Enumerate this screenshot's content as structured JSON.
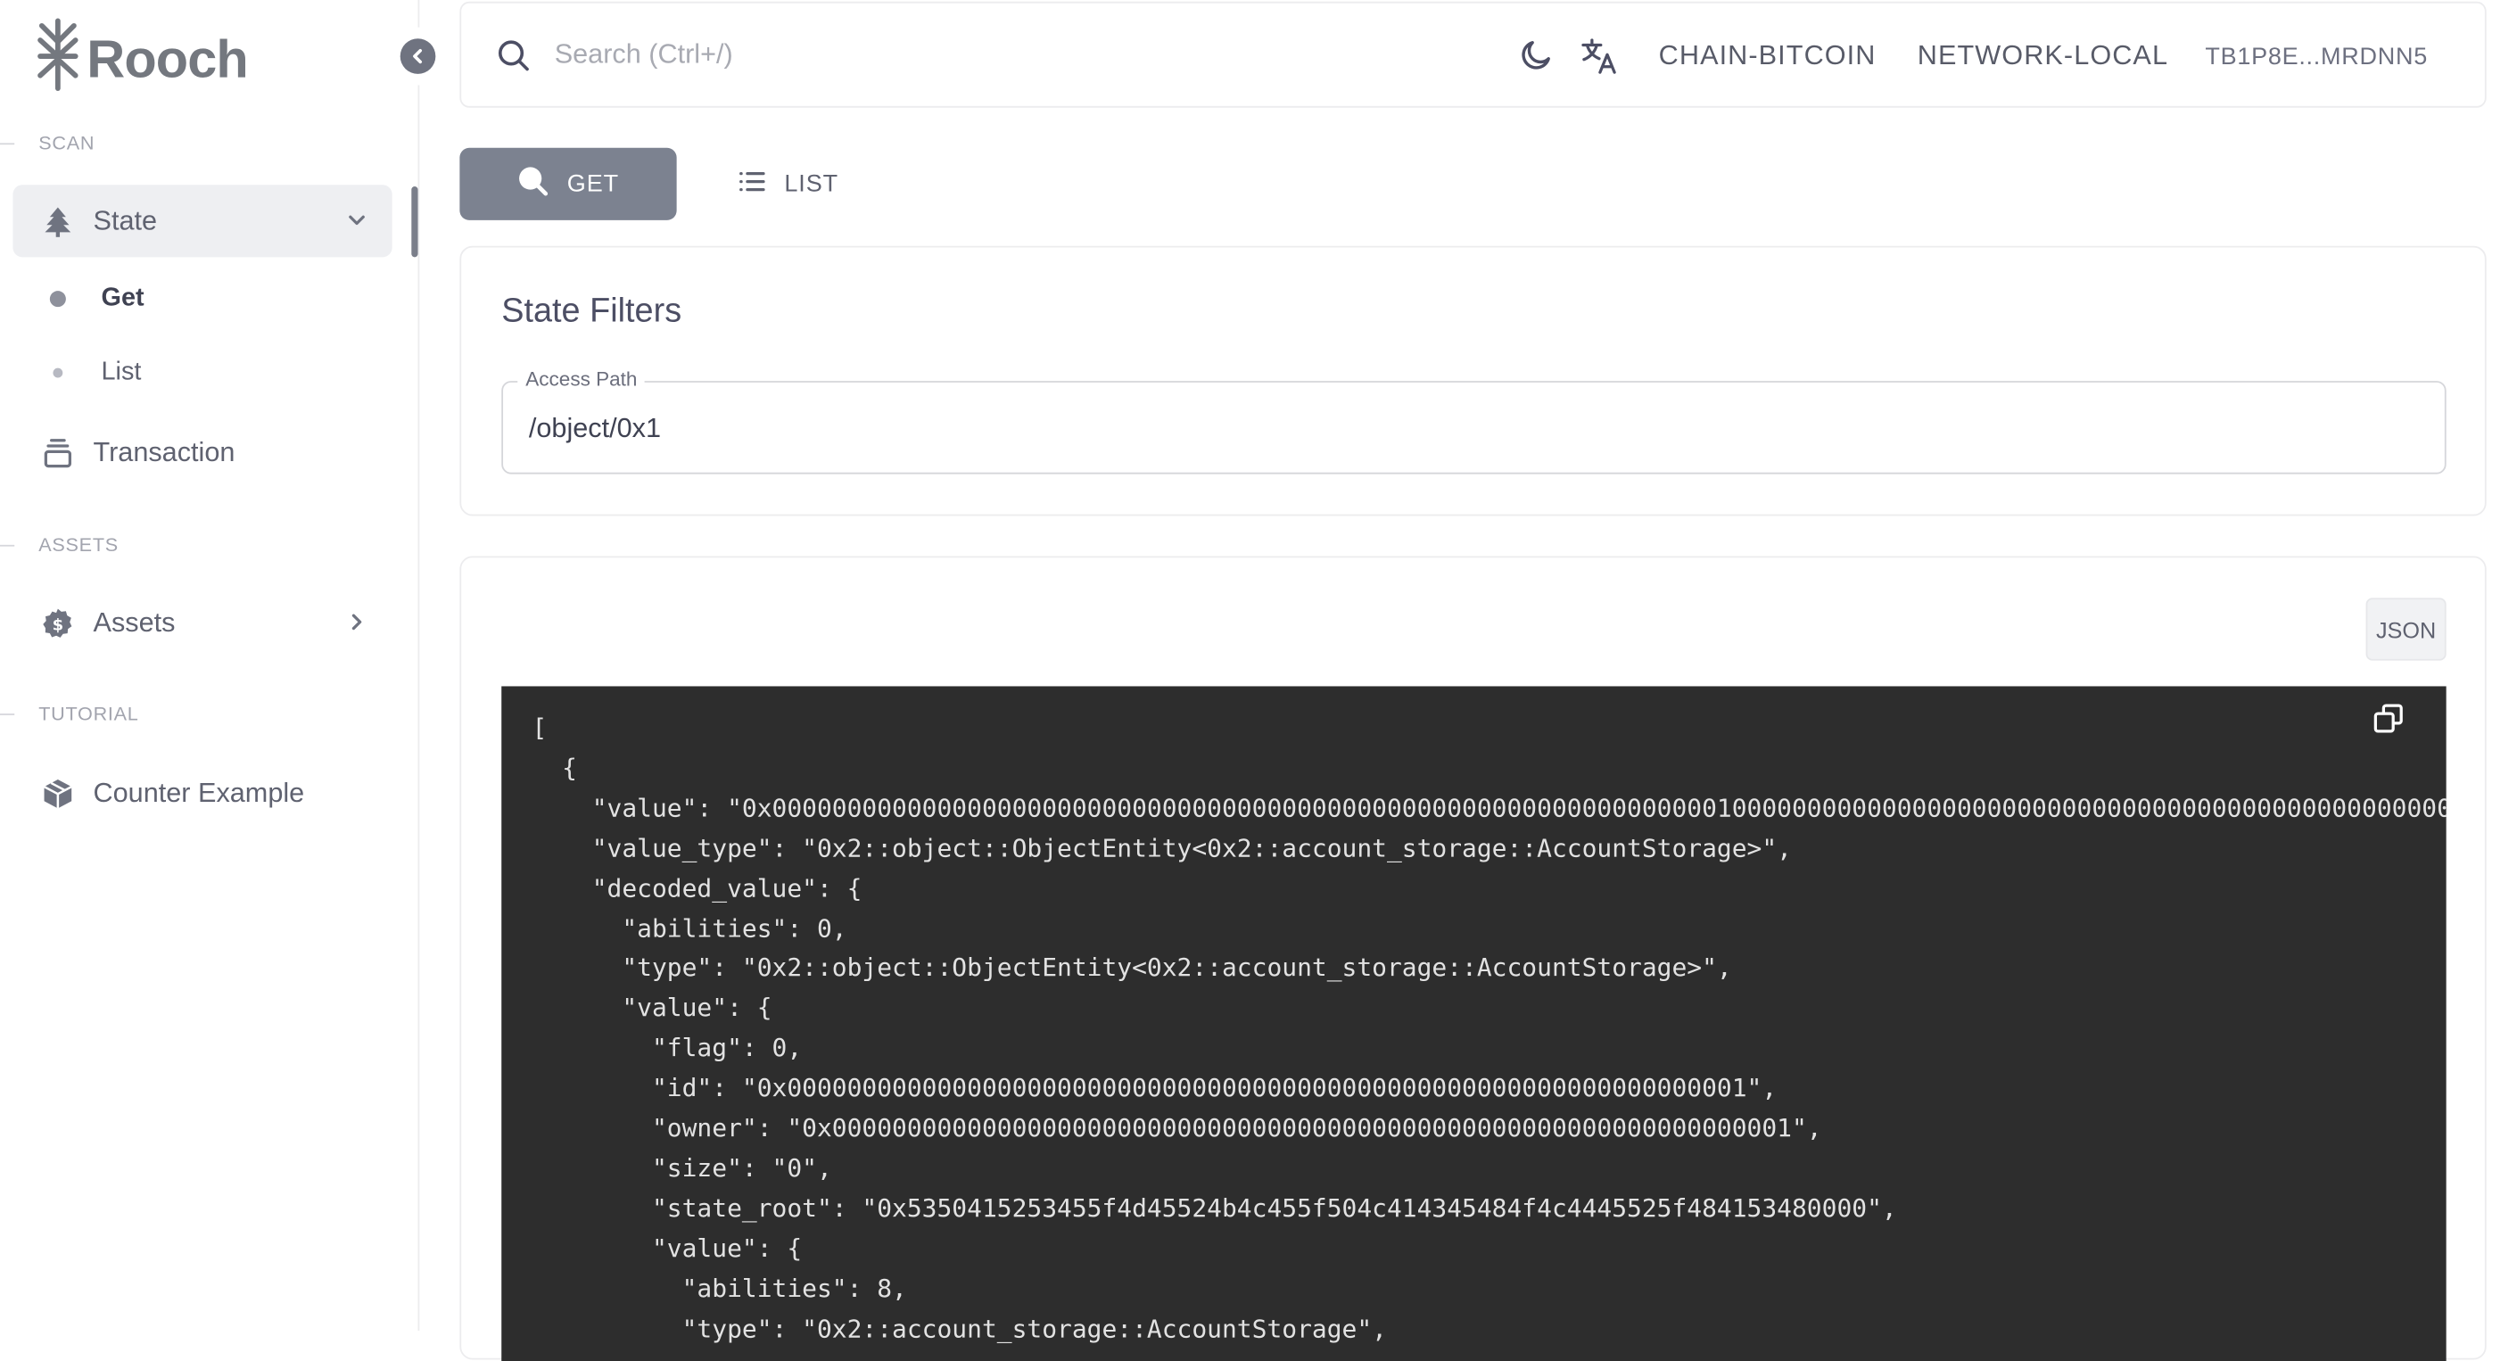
{
  "brand": {
    "name": "Rooch"
  },
  "sidebar": {
    "sections": {
      "scan": "SCAN",
      "assets": "ASSETS",
      "tutorial": "TUTORIAL"
    },
    "state": {
      "label": "State",
      "icon": "tree-icon",
      "expanded": true
    },
    "state_children": [
      {
        "label": "Get",
        "active": true
      },
      {
        "label": "List",
        "active": false
      }
    ],
    "transaction": {
      "label": "Transaction",
      "icon": "stack-icon"
    },
    "assets": {
      "label": "Assets",
      "icon": "dollar-badge-icon"
    },
    "counter_example": {
      "label": "Counter Example",
      "icon": "package-icon"
    }
  },
  "topbar": {
    "search_placeholder": "Search (Ctrl+/)",
    "chain": "CHAIN-BITCOIN",
    "network": "NETWORK-LOCAL",
    "wallet": "TB1P8E...MRDNN5"
  },
  "tabs": {
    "get": "GET",
    "list": "LIST"
  },
  "filters": {
    "title": "State Filters",
    "access_path_label": "Access Path",
    "access_path_value": "/object/0x1"
  },
  "result": {
    "format_button": "JSON",
    "json_text": "[\n  {\n    \"value\": \"0x0000000000000000000000000000000000000000000000000000000000000001000000000000000000000000000000000000000000000000000000000000000000\n    \"value_type\": \"0x2::object::ObjectEntity<0x2::account_storage::AccountStorage>\",\n    \"decoded_value\": {\n      \"abilities\": 0,\n      \"type\": \"0x2::object::ObjectEntity<0x2::account_storage::AccountStorage>\",\n      \"value\": {\n        \"flag\": 0,\n        \"id\": \"0x0000000000000000000000000000000000000000000000000000000000000001\",\n        \"owner\": \"0x0000000000000000000000000000000000000000000000000000000000000001\",\n        \"size\": \"0\",\n        \"state_root\": \"0x5350415253455f4d45524b4c455f504c414345484f4c4445525f484153480000\",\n        \"value\": {\n          \"abilities\": 8,\n          \"type\": \"0x2::account_storage::AccountStorage\","
  },
  "colors": {
    "accent": "#7c8290",
    "code_background": "#2d2d2d",
    "text_primary": "#4c4e64"
  }
}
